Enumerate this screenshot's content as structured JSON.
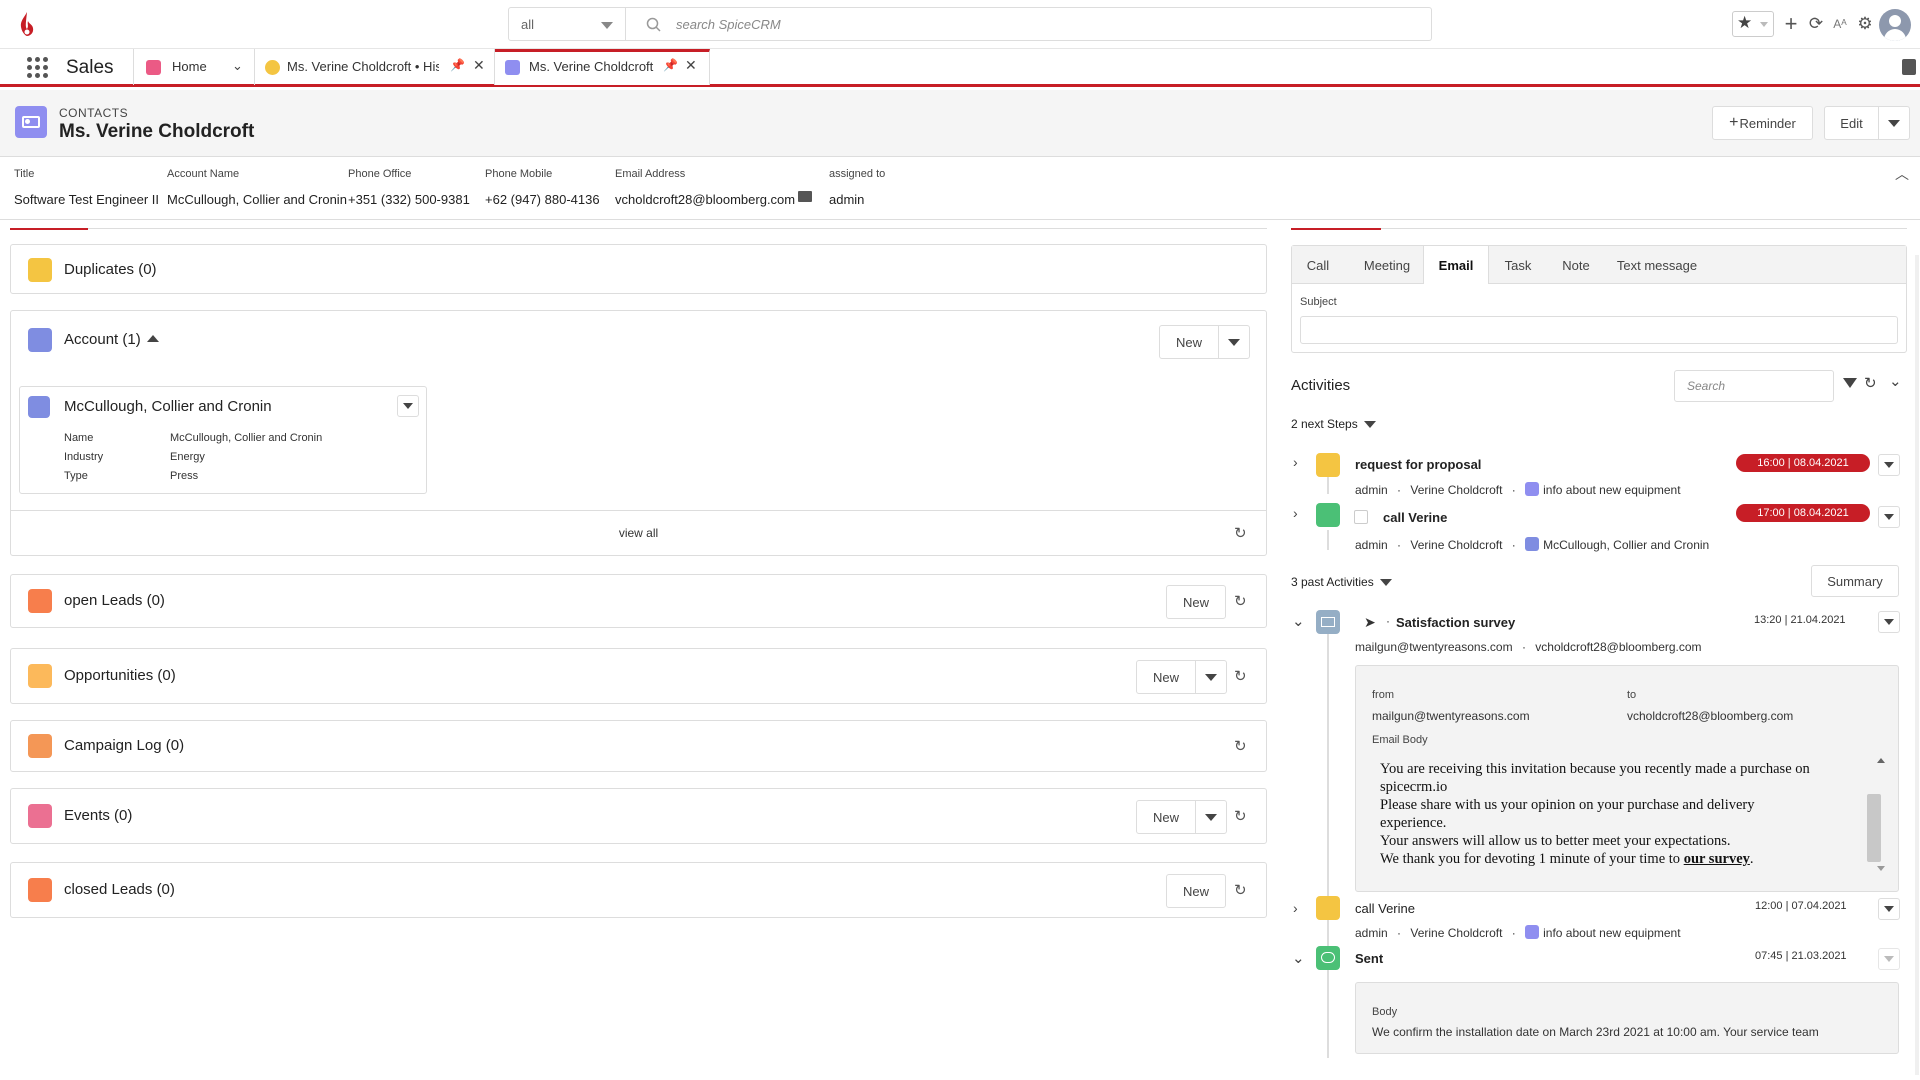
{
  "topbar": {
    "scope_value": "all",
    "search_placeholder": "search SpiceCRM"
  },
  "nav": {
    "app_name": "Sales",
    "tabs": [
      {
        "label": "Home"
      },
      {
        "label": "Ms. Verine Choldcroft • Hist"
      },
      {
        "label": "Ms. Verine Choldcroft"
      }
    ]
  },
  "header": {
    "module": "CONTACTS",
    "title": "Ms. Verine Choldcroft",
    "reminder_label": "Reminder",
    "edit_label": "Edit"
  },
  "fields": [
    {
      "label": "Title",
      "value": "Software Test Engineer II"
    },
    {
      "label": "Account Name",
      "value": "McCullough, Collier and Cronin"
    },
    {
      "label": "Phone Office",
      "value": "+351 (332) 500-9381"
    },
    {
      "label": "Phone Mobile",
      "value": "+62 (947) 880-4136"
    },
    {
      "label": "Email Address",
      "value": "vcholdcroft28@bloomberg.com"
    },
    {
      "label": "assigned to",
      "value": "admin"
    }
  ],
  "panels": {
    "duplicates": "Duplicates (0)",
    "account": "Account (1)",
    "account_new": "New",
    "account_card": {
      "title": "McCullough, Collier and Cronin",
      "rows": [
        {
          "k": "Name",
          "v": "McCullough, Collier and Cronin"
        },
        {
          "k": "Industry",
          "v": "Energy"
        },
        {
          "k": "Type",
          "v": "Press"
        }
      ]
    },
    "view_all": "view all",
    "open_leads": "open Leads (0)",
    "opportunities": "Opportunities (0)",
    "campaign_log": "Campaign Log (0)",
    "events": "Events (0)",
    "closed_leads": "closed Leads (0)",
    "new_label": "New"
  },
  "activity_tabs": [
    "Call",
    "Meeting",
    "Email",
    "Task",
    "Note",
    "Text message"
  ],
  "subject_label": "Subject",
  "activities": {
    "title": "Activities",
    "search_placeholder": "Search",
    "next_steps": "2 next Steps",
    "past_activities": "3 past Activities",
    "summary_label": "Summary",
    "items": [
      {
        "title": "request for proposal",
        "user": "admin",
        "contact": "Verine Choldcroft",
        "related": "info about new equipment",
        "date": "16:00 | 08.04.2021"
      },
      {
        "title": "call Verine",
        "user": "admin",
        "contact": "Verine Choldcroft",
        "related": "McCullough, Collier and Cronin",
        "date": "17:00 | 08.04.2021"
      }
    ],
    "email": {
      "title": "Satisfaction survey",
      "date": "13:20 | 21.04.2021",
      "from_addr": "mailgun@twentyreasons.com",
      "to_addr": "vcholdcroft28@bloomberg.com",
      "from_label": "from",
      "to_label": "to",
      "body_label": "Email Body",
      "body_lines": [
        "You are receiving this invitation because you recently made a purchase on",
        "spicecrm.io",
        "Please share with us your opinion on your purchase and delivery",
        "experience.",
        "Your answers will allow us to better meet your expectations."
      ],
      "body_last_prefix": "We thank you for devoting 1 minute of your time to ",
      "body_link": "our survey",
      "body_last_suffix": "."
    },
    "past_call": {
      "title": "call Verine",
      "date": "12:00 | 07.04.2021",
      "user": "admin",
      "contact": "Verine Choldcroft",
      "related": "info about new equipment"
    },
    "sms": {
      "title": "Sent",
      "date": "07:45 | 21.03.2021",
      "body_label": "Body",
      "body": "We confirm the installation date on March 23rd 2021 at 10:00 am. Your service team"
    }
  },
  "colors": {
    "accent": "#c71e26",
    "contact_icon": "#8f8ef0",
    "duplicates_icon": "#f4c542",
    "account_icon": "#7f8de1",
    "lead_icon": "#f77e4c",
    "opportunity_icon": "#fcb95b",
    "campaign_icon": "#f49756",
    "events_icon": "#eb7092",
    "call_icon": "#f4c542",
    "task_icon": "#4bc076",
    "email_icon": "#95aec5",
    "sms_icon": "#4bc076"
  }
}
